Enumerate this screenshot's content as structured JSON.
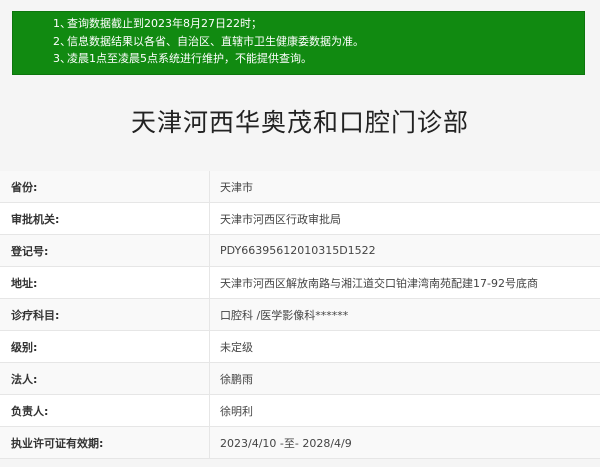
{
  "notice": {
    "items": [
      {
        "num": "1、",
        "text": "查询数据截止到2023年8月27日22时；"
      },
      {
        "num": "2、",
        "text": "信息数据结果以各省、自治区、直辖市卫生健康委数据为准。"
      },
      {
        "num": "3、",
        "text": "凌晨1点至凌晨5点系统进行维护，不能提供查询。"
      }
    ]
  },
  "title": "天津河西华奥茂和口腔门诊部",
  "rows": [
    {
      "label": "省份:",
      "value": "天津市"
    },
    {
      "label": "审批机关:",
      "value": "天津市河西区行政审批局"
    },
    {
      "label": "登记号:",
      "value": "PDY66395612010315D1522"
    },
    {
      "label": "地址:",
      "value": "天津市河西区解放南路与湘江道交口铂津湾南苑配建17-92号底商"
    },
    {
      "label": "诊疗科目:",
      "value": "口腔科 /医学影像科******"
    },
    {
      "label": "级别:",
      "value": "未定级"
    },
    {
      "label": "法人:",
      "value": "徐鹏雨"
    },
    {
      "label": "负责人:",
      "value": "徐明利"
    },
    {
      "label": "执业许可证有效期:",
      "value": "2023/4/10 -至- 2028/4/9"
    }
  ],
  "colors": {
    "notice_bg": "#118a11",
    "notice_text": "#ffffff",
    "page_bg": "#f5f5f5"
  }
}
